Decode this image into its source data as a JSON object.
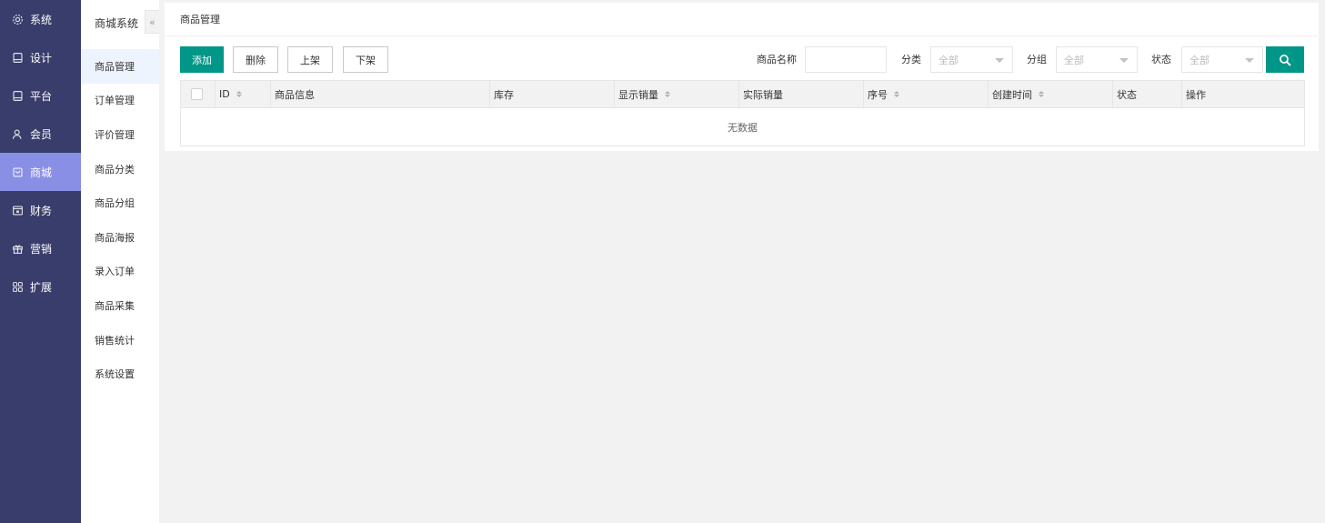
{
  "nav": {
    "items": [
      {
        "label": "系统",
        "icon": "gear-icon"
      },
      {
        "label": "设计",
        "icon": "monitor-icon"
      },
      {
        "label": "平台",
        "icon": "monitor-icon"
      },
      {
        "label": "会员",
        "icon": "user-icon"
      },
      {
        "label": "商城",
        "icon": "shop-icon"
      },
      {
        "label": "财务",
        "icon": "wallet-icon"
      },
      {
        "label": "营销",
        "icon": "gift-icon"
      },
      {
        "label": "扩展",
        "icon": "grid-icon"
      }
    ],
    "active_index": 4,
    "colors": {
      "background": "#393d6b",
      "active": "#8a8fe6"
    }
  },
  "submenu": {
    "title": "商城系统",
    "collapse_glyph": "«",
    "items": [
      {
        "label": "商品管理"
      },
      {
        "label": "订单管理"
      },
      {
        "label": "评价管理"
      },
      {
        "label": "商品分类"
      },
      {
        "label": "商品分组"
      },
      {
        "label": "商品海报"
      },
      {
        "label": "录入订单"
      },
      {
        "label": "商品采集"
      },
      {
        "label": "销售统计"
      },
      {
        "label": "系统设置"
      }
    ],
    "active_index": 0
  },
  "main": {
    "title": "商品管理",
    "buttons": {
      "add": "添加",
      "delete": "删除",
      "on_shelf": "上架",
      "off_shelf": "下架"
    },
    "filters": {
      "name_label": "商品名称",
      "name_value": "",
      "category_label": "分类",
      "category_value": "全部",
      "group_label": "分组",
      "group_value": "全部",
      "status_label": "状态",
      "status_value": "全部",
      "search_icon": "search-icon"
    },
    "table": {
      "columns": [
        "ID",
        "商品信息",
        "库存",
        "显示销量",
        "实际销量",
        "序号",
        "创建时间",
        "状态",
        "操作"
      ],
      "sortable": [
        "ID",
        "显示销量",
        "序号",
        "创建时间"
      ],
      "empty_text": "无数据"
    },
    "colors": {
      "primary": "#009688"
    }
  }
}
